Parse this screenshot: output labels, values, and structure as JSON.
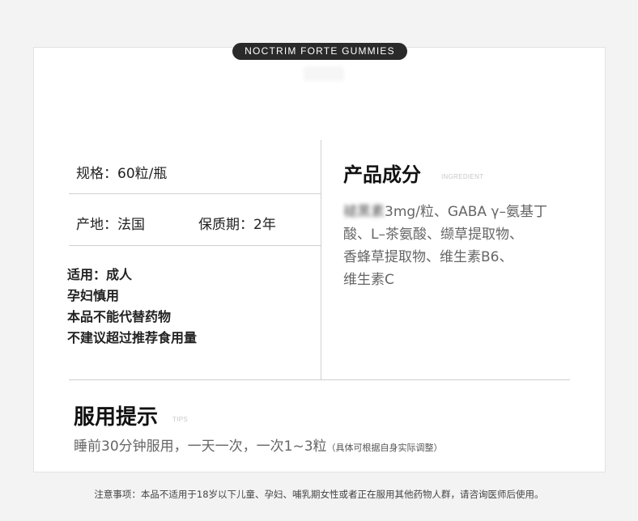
{
  "badge": "NOCTRIM FORTE GUMMIES",
  "specs": {
    "spec_label": "规格：",
    "spec_value": "60粒/瓶",
    "origin_label": "产地：",
    "origin_value": "法国",
    "shelf_label": "保质期：",
    "shelf_value": "2年"
  },
  "usage_lines": [
    "适用：成人",
    "孕妇慎用",
    "本品不能代替药物",
    "不建议超过推荐食用量"
  ],
  "ingredients": {
    "title": "产品成分",
    "subtitle": "INGREDIENT",
    "line1_blurred": "褪黑素",
    "line1_rest": "3mg/粒、GABA γ–氨基丁",
    "line2": "酸、L–茶氨酸、缬草提取物、",
    "line3": "香蜂草提取物、维生素B6、",
    "line4": "维生素C"
  },
  "tips": {
    "title": "服用提示",
    "subtitle": "TIPS",
    "dosage": "睡前30分钟服用，一天一次，一次1~3粒",
    "dosage_note": "（具体可根据自身实际调整）"
  },
  "footer": "注意事项：本品不适用于18岁以下儿童、孕妇、哺乳期女性或者正在服用其他药物人群，请咨询医师后使用。"
}
